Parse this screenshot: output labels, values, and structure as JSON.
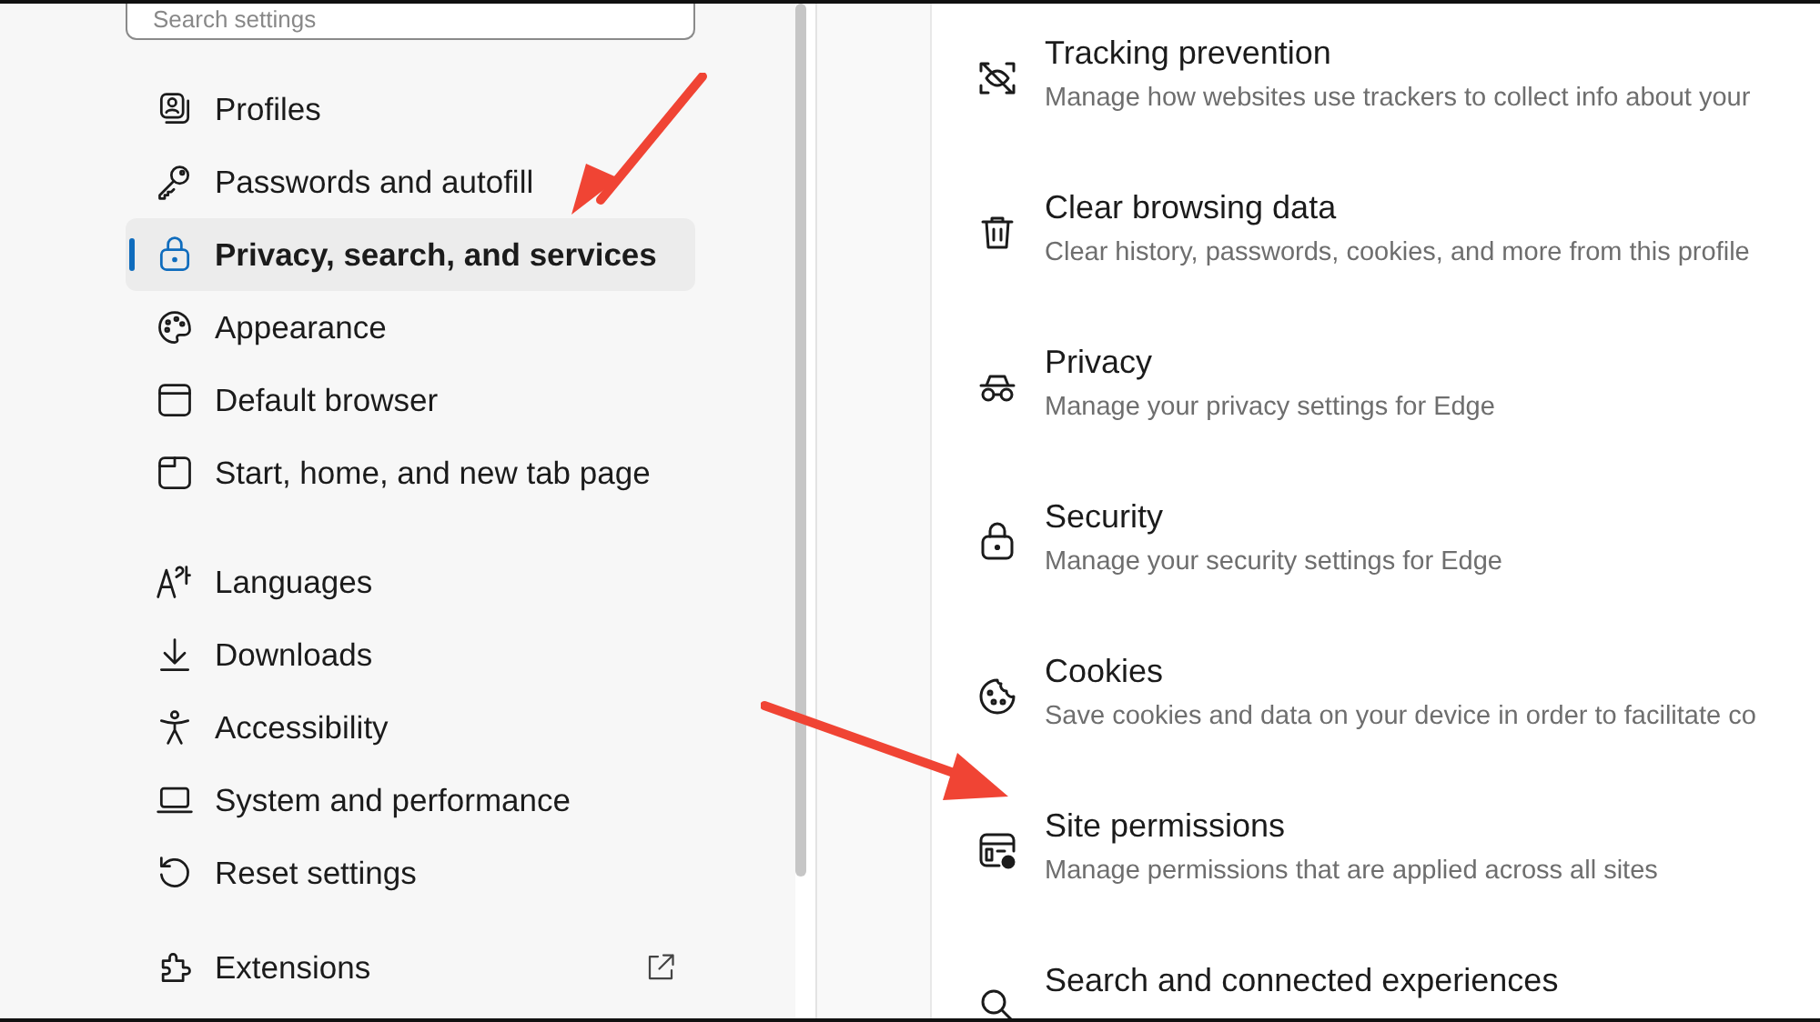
{
  "search": {
    "placeholder": "Search settings"
  },
  "sidebar": {
    "groups": [
      {
        "items": [
          {
            "label": "Profiles",
            "selected": false
          },
          {
            "label": "Passwords and autofill",
            "selected": false
          },
          {
            "label": "Privacy, search, and services",
            "selected": true
          },
          {
            "label": "Appearance",
            "selected": false
          },
          {
            "label": "Default browser",
            "selected": false
          },
          {
            "label": "Start, home, and new tab page",
            "selected": false
          }
        ]
      },
      {
        "items": [
          {
            "label": "Languages",
            "selected": false
          },
          {
            "label": "Downloads",
            "selected": false
          },
          {
            "label": "Accessibility",
            "selected": false
          },
          {
            "label": "System and performance",
            "selected": false
          },
          {
            "label": "Reset settings",
            "selected": false
          }
        ]
      },
      {
        "items": [
          {
            "label": "Extensions",
            "selected": false,
            "external": true
          }
        ]
      }
    ]
  },
  "settings": [
    {
      "title": "Tracking prevention",
      "description": "Manage how websites use trackers to collect info about your"
    },
    {
      "title": "Clear browsing data",
      "description": "Clear history, passwords, cookies, and more from this profile"
    },
    {
      "title": "Privacy",
      "description": "Manage your privacy settings for Edge"
    },
    {
      "title": "Security",
      "description": "Manage your security settings for Edge"
    },
    {
      "title": "Cookies",
      "description": "Save cookies and data on your device in order to facilitate co"
    },
    {
      "title": "Site permissions",
      "description": "Manage permissions that are applied across all sites"
    },
    {
      "title": "Search and connected experiences"
    }
  ],
  "annotations": [
    {
      "kind": "arrow"
    },
    {
      "kind": "arrow"
    }
  ]
}
